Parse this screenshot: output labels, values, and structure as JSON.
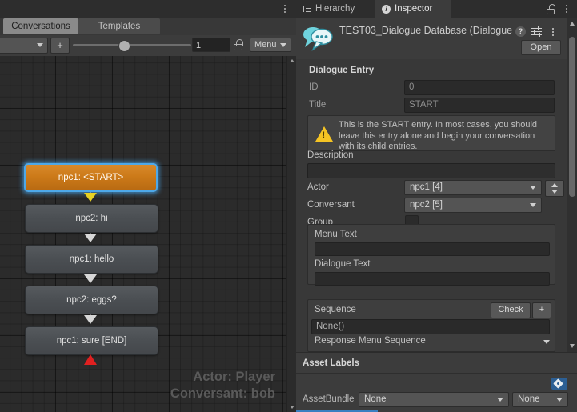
{
  "editor": {
    "tabs": [
      {
        "id": "conversations",
        "label": "Conversations",
        "active": true
      },
      {
        "id": "templates",
        "label": "Templates",
        "active": false
      }
    ],
    "toolbar": {
      "conversation_dropdown_value": "",
      "add_button_label": "+",
      "zoom_slider_value": 38,
      "numeric_field_value": "1",
      "lock_icon": "lock-open-icon",
      "menu_label": "Menu"
    },
    "canvas": {
      "nodes": [
        {
          "id": "start",
          "label": "npc1: <START>",
          "selected": true
        },
        {
          "id": "n1",
          "label": "npc2: hi",
          "selected": false
        },
        {
          "id": "n2",
          "label": "npc1: hello",
          "selected": false
        },
        {
          "id": "n3",
          "label": "npc2: eggs?",
          "selected": false
        },
        {
          "id": "n4",
          "label": "npc1: sure [END]",
          "selected": false
        }
      ],
      "overlay": {
        "actor_line": "Actor: Player",
        "conversant_line": "Conversant: bob"
      },
      "link_colors": {
        "start_link": "#e8d123",
        "normal_link": "#d7d7d7",
        "end_marker": "#e02020"
      }
    }
  },
  "inspector": {
    "window_tabs": [
      {
        "id": "hierarchy",
        "label": "Hierarchy",
        "icon": "hierarchy-icon",
        "active": false
      },
      {
        "id": "inspector",
        "label": "Inspector",
        "icon": "info-icon",
        "active": true
      }
    ],
    "asset": {
      "name": "TEST03_Dialogue Database (Dialogue",
      "icon": "dialogue-bubble-icon",
      "open_button": "Open",
      "help_icon": "help-icon",
      "preset_icon": "preset-icon",
      "more_icon": "kebab-menu-icon"
    },
    "dialogue_entry": {
      "section_title": "Dialogue Entry",
      "fields": {
        "id_label": "ID",
        "id_value": "0",
        "title_label": "Title",
        "title_value": "START",
        "description_label": "Description",
        "description_value": "",
        "actor_label": "Actor",
        "actor_value": "npc1 [4]",
        "conversant_label": "Conversant",
        "conversant_value": "npc2 [5]",
        "group_label": "Group",
        "group_checked": false
      },
      "warning": "This is the START entry. In most cases, you should leave this entry alone and begin your conversation with its child entries.",
      "menu_text_label": "Menu Text",
      "menu_text_value": "",
      "dialogue_text_label": "Dialogue Text",
      "dialogue_text_value": "",
      "sequence_label": "Sequence",
      "sequence_check_button": "Check",
      "sequence_add_button": "+",
      "sequence_value": "None()",
      "response_menu_sequence_label": "Response Menu Sequence"
    },
    "asset_labels": {
      "title": "Asset Labels",
      "tag_icon": "tag-icon",
      "assetbundle_label": "AssetBundle",
      "assetbundle_value": "None",
      "assetvariant_value": "None"
    }
  },
  "colors": {
    "accent_blue": "#3a7fc1",
    "selection_glow": "#4ea8e8",
    "start_node": "#cc7a19",
    "warning_yellow": "#f5c424",
    "end_red": "#e02020",
    "panel_bg": "#383838"
  }
}
